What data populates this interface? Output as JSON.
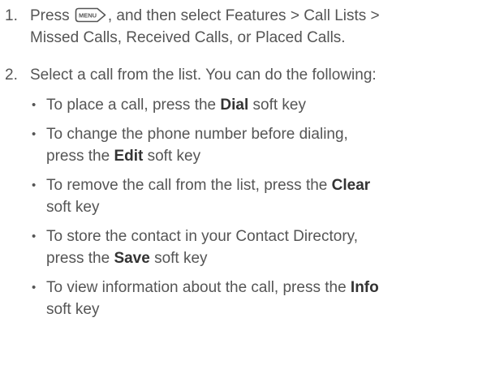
{
  "steps": [
    {
      "number": "1.",
      "text_before_icon": "Press",
      "icon": "menu-key-icon",
      "icon_label": "MENU",
      "text_after_icon": ", and then select Features > Call Lists >",
      "text_line2": "Missed Calls, Received Calls, or Placed Calls."
    },
    {
      "number": "2.",
      "text": "Select a call from the list. You can do the following:",
      "bullets": [
        {
          "lines": [
            {
              "before": "To place a call, press the ",
              "bold": "Dial",
              "after": " soft key"
            }
          ]
        },
        {
          "lines": [
            {
              "before": "To change the phone number before dialing,",
              "bold": "",
              "after": ""
            },
            {
              "before": "press the ",
              "bold": "Edit",
              "after": " soft key"
            }
          ]
        },
        {
          "lines": [
            {
              "before": "To remove the call from the list, press the ",
              "bold": "Clear",
              "after": ""
            },
            {
              "before": "soft key",
              "bold": "",
              "after": ""
            }
          ]
        },
        {
          "lines": [
            {
              "before": "To store the contact in your Contact Directory,",
              "bold": "",
              "after": ""
            },
            {
              "before": "press the ",
              "bold": "Save",
              "after": " soft key"
            }
          ]
        },
        {
          "lines": [
            {
              "before": "To view information about the call, press the ",
              "bold": "Info",
              "after": ""
            },
            {
              "before": "soft key",
              "bold": "",
              "after": ""
            }
          ]
        }
      ]
    }
  ],
  "bullet_glyph": "•",
  "colors": {
    "text": "#555555",
    "bold_text": "#333333",
    "icon_stroke": "#555555"
  }
}
